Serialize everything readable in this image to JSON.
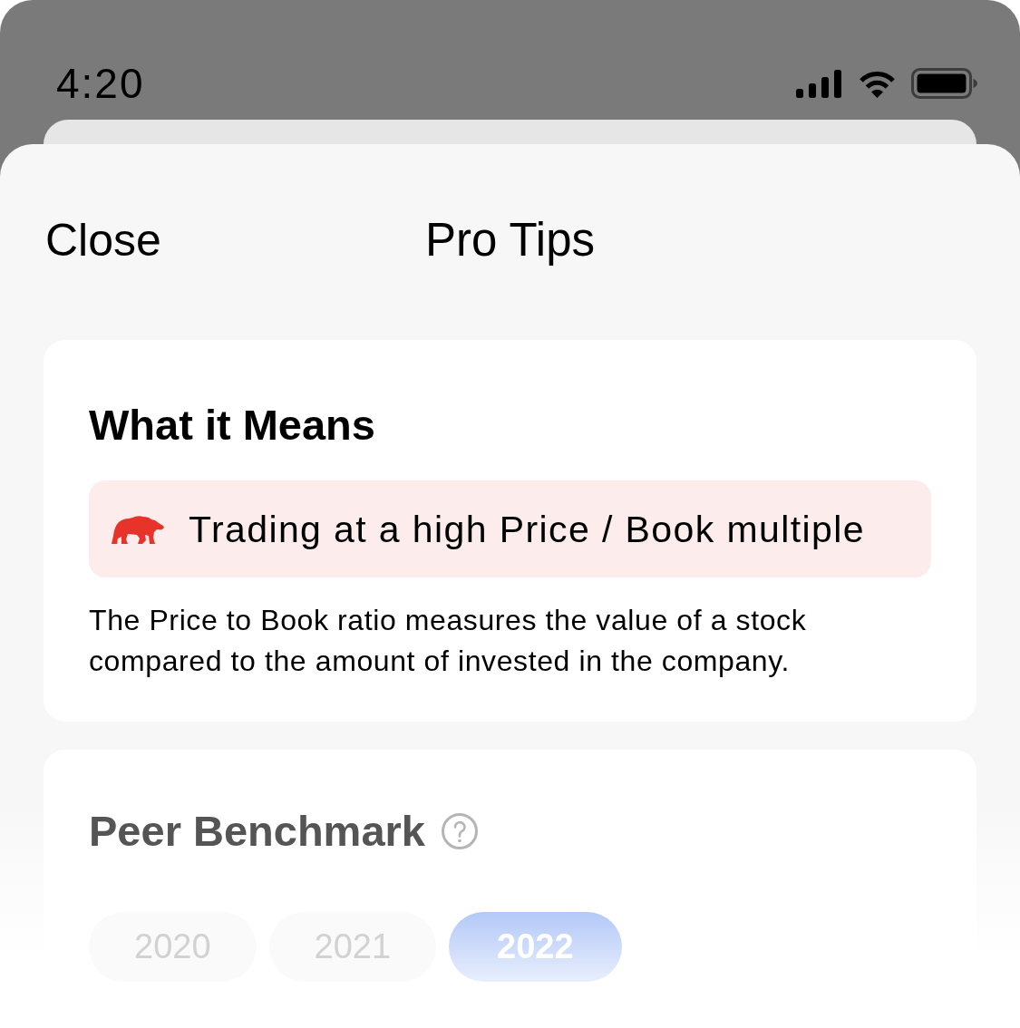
{
  "status_bar": {
    "time": "4:20"
  },
  "nav": {
    "close": "Close",
    "title": "Pro Tips"
  },
  "meaning_card": {
    "title": "What it Means",
    "signal": {
      "kind": "bearish",
      "text": "Trading at a high Price / Book multiple"
    },
    "description": "The Price to Book ratio measures the value of a stock compared to the amount of invested in the company."
  },
  "benchmark_card": {
    "title": "Peer Benchmark",
    "years": [
      {
        "label": "2020",
        "selected": false
      },
      {
        "label": "2021",
        "selected": false
      },
      {
        "label": "2022",
        "selected": true
      }
    ]
  }
}
